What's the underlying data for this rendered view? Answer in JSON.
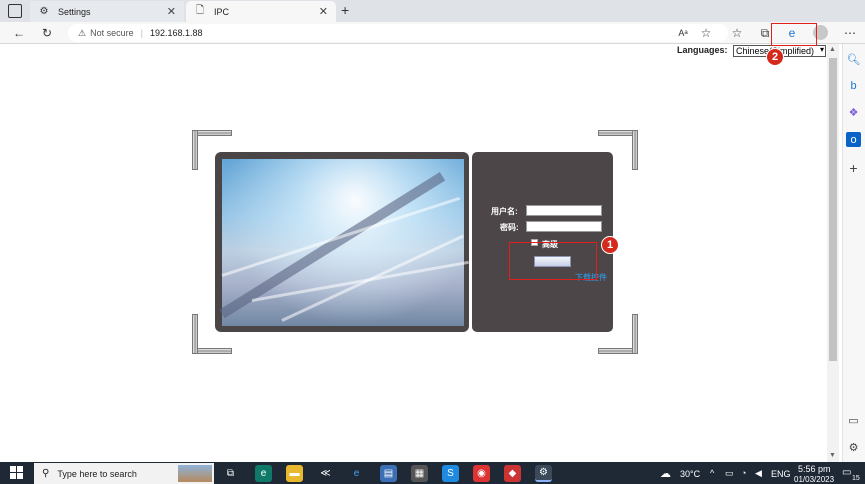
{
  "browser": {
    "tabs": [
      {
        "title": "Settings",
        "icon": "gear-icon"
      },
      {
        "title": "IPC",
        "icon": "page-icon"
      }
    ],
    "new_tab": "+",
    "security_label": "Not secure",
    "url": "192.168.1.88"
  },
  "page": {
    "languages_label": "Languages:",
    "language_selected": "Chinese(Simplified)",
    "username_label": "用户名:",
    "password_label": "密码:",
    "advanced_label": "高级",
    "login_button": "",
    "download_link": "下载控件"
  },
  "annotations": {
    "badge_1": "1",
    "badge_2": "2",
    "color": "#e0201c"
  },
  "taskbar": {
    "search_placeholder": "Type here to search",
    "temperature": "30°C",
    "language": "ENG",
    "time": "5:56 pm",
    "date": "01/03/2023",
    "notifications": "15"
  }
}
